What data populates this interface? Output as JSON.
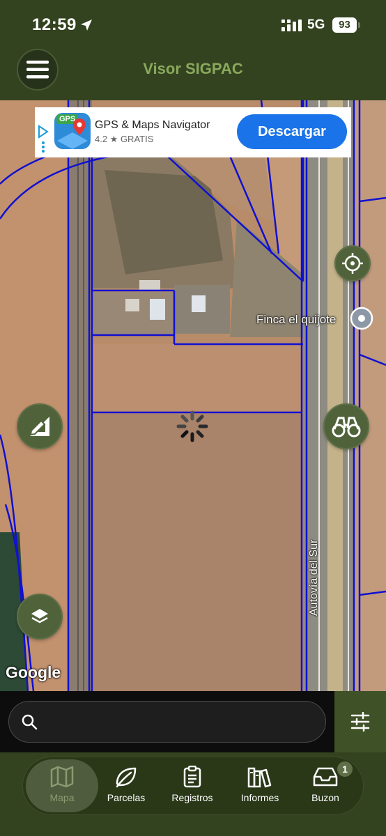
{
  "status_bar": {
    "time": "12:59",
    "network": "5G",
    "battery": "93"
  },
  "header": {
    "title": "Visor SIGPAC"
  },
  "ad": {
    "app_name": "GPS & Maps Navigator",
    "icon_badge": "GPS",
    "rating": "4.2 ★ GRATIS",
    "cta_label": "Descargar"
  },
  "map": {
    "place_label": "Finca el quijote",
    "road_label": "Autovía del Sur",
    "attribution": "Google",
    "parcel_line_color": "#1010d0"
  },
  "search": {
    "placeholder": ""
  },
  "nav": {
    "items": [
      {
        "label": "Mapa",
        "icon": "map-icon",
        "active": true
      },
      {
        "label": "Parcelas",
        "icon": "leaf-icon",
        "active": false
      },
      {
        "label": "Registros",
        "icon": "clipboard-icon",
        "active": false
      },
      {
        "label": "Informes",
        "icon": "books-icon",
        "active": false
      },
      {
        "label": "Buzon",
        "icon": "inbox-icon",
        "active": false
      }
    ],
    "buzon_badge": "1"
  },
  "colors": {
    "primary": "#33431f",
    "accent": "#8aa85d",
    "cta": "#1a73e8"
  }
}
